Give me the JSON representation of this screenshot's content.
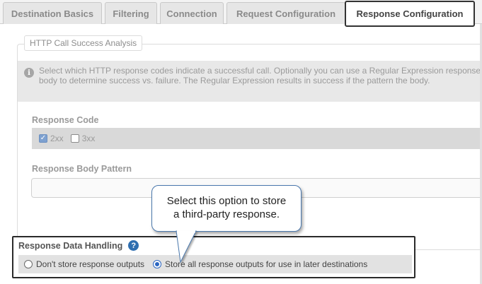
{
  "tabs": [
    {
      "label": "Destination Basics",
      "active": false
    },
    {
      "label": "Filtering",
      "active": false
    },
    {
      "label": "Connection",
      "active": false
    },
    {
      "label": "Request Configuration",
      "active": false
    },
    {
      "label": "Response Configuration",
      "active": true
    }
  ],
  "http_success": {
    "legend": "HTTP Call Success Analysis",
    "info_text": "Select which HTTP response codes indicate a successful call. Optionally you can use a Regular Expression response body to determine success vs. failure. The Regular Expression results in success if the pattern the body.",
    "response_code_label": "Response Code",
    "codes": [
      {
        "label": "2xx",
        "checked": true
      },
      {
        "label": "3xx",
        "checked": false
      }
    ],
    "body_pattern_label": "Response Body Pattern",
    "body_pattern_value": ""
  },
  "callout": {
    "line1": "Select this option to store",
    "line2": "a third-party response."
  },
  "response_data_handling": {
    "label": "Response Data Handling",
    "help_glyph": "?",
    "options": [
      {
        "label": "Don't store response outputs",
        "selected": false
      },
      {
        "label": "Store all response outputs for use in later destinations",
        "selected": true
      }
    ]
  },
  "colors": {
    "active_tab_border": "#333333",
    "callout_border": "#4a78ad",
    "help_icon": "#2f6fb0",
    "radio_selected": "#2b66c1"
  }
}
